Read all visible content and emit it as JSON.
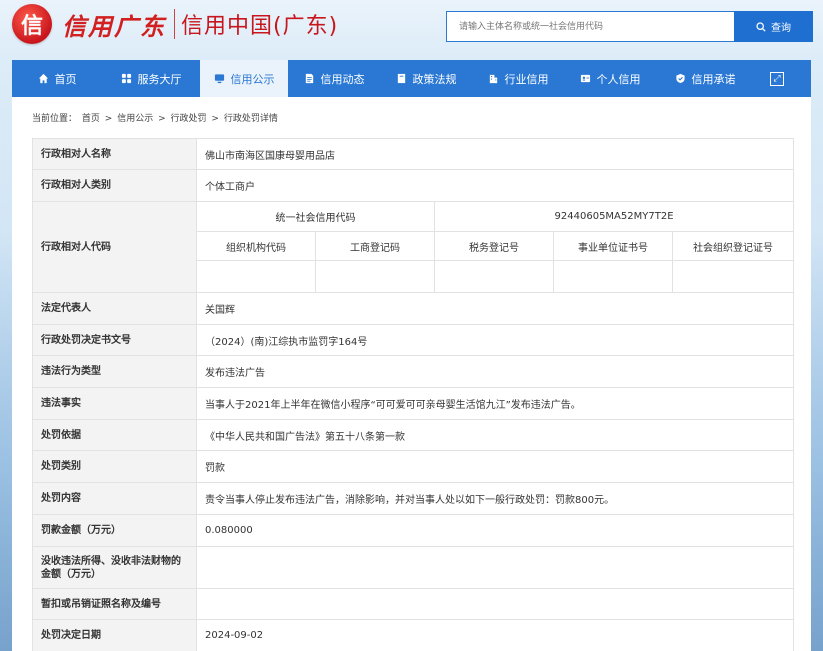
{
  "header": {
    "logo_emblem": "信",
    "logo_script": "信用广东",
    "logo_title": "信用中国(广东)"
  },
  "search": {
    "placeholder": "请输入主体名称或统一社会信用代码",
    "button_label": "查询"
  },
  "nav": {
    "items": [
      {
        "label": "首页",
        "icon": "home-icon"
      },
      {
        "label": "服务大厅",
        "icon": "grid-icon"
      },
      {
        "label": "信用公示",
        "icon": "monitor-icon",
        "active": true
      },
      {
        "label": "信用动态",
        "icon": "document-icon"
      },
      {
        "label": "政策法规",
        "icon": "book-icon"
      },
      {
        "label": "行业信用",
        "icon": "building-icon"
      },
      {
        "label": "个人信用",
        "icon": "id-card-icon"
      },
      {
        "label": "信用承诺",
        "icon": "shield-check-icon"
      }
    ],
    "expand_icon": "expand-icon"
  },
  "breadcrumb": {
    "prefix": "当前位置：",
    "items": [
      "首页",
      "信用公示",
      "行政处罚",
      "行政处罚详情"
    ],
    "separator": ">"
  },
  "detail": {
    "rows": [
      {
        "label": "行政相对人名称",
        "value": "佛山市南海区国康母婴用品店"
      },
      {
        "label": "行政相对人类别",
        "value": "个体工商户"
      },
      {
        "label": "行政相对人代码"
      },
      {
        "label": "法定代表人",
        "value": "关国辉"
      },
      {
        "label": "行政处罚决定书文号",
        "value": "（2024）(南)江综执市监罚字164号"
      },
      {
        "label": "违法行为类型",
        "value": "发布违法广告"
      },
      {
        "label": "违法事实",
        "value": "当事人于2021年上半年在微信小程序“可可爱可可亲母婴生活馆九江”发布违法广告。"
      },
      {
        "label": "处罚依据",
        "value": "《中华人民共和国广告法》第五十八条第一款"
      },
      {
        "label": "处罚类别",
        "value": "罚款"
      },
      {
        "label": "处罚内容",
        "value": "责令当事人停止发布违法广告，消除影响，并对当事人处以如下一般行政处罚：罚款800元。"
      },
      {
        "label": "罚款金额（万元）",
        "value": "0.080000"
      },
      {
        "label": "没收违法所得、没收非法财物的金额（万元）",
        "value": ""
      },
      {
        "label": "暂扣或吊销证照名称及编号",
        "value": ""
      },
      {
        "label": "处罚决定日期",
        "value": "2024-09-02"
      }
    ],
    "codes": {
      "uscc_label": "统一社会信用代码",
      "uscc_value": "92440605MA52MY7T2E",
      "sub_labels": [
        "组织机构代码",
        "工商登记码",
        "税务登记号",
        "事业单位证书号",
        "社会组织登记证号"
      ],
      "sub_values": [
        "",
        "",
        "",
        "",
        ""
      ]
    }
  }
}
